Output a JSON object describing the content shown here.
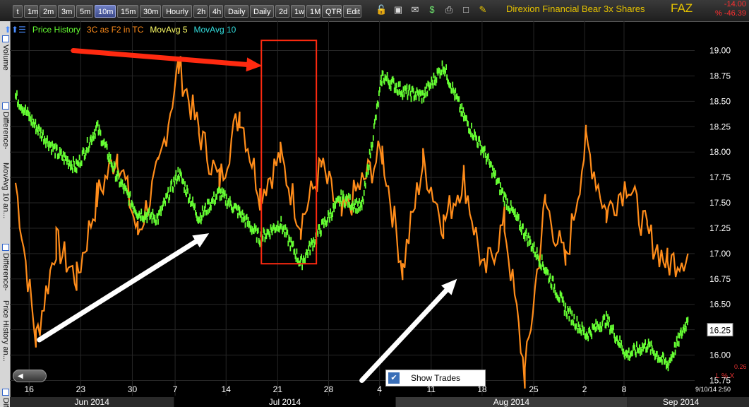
{
  "toolbar": {
    "buttons": [
      {
        "label": "t",
        "active": false
      },
      {
        "label": "1m",
        "active": false
      },
      {
        "label": "2m",
        "active": false
      },
      {
        "label": "3m",
        "active": false
      },
      {
        "label": "5m",
        "active": false
      },
      {
        "label": "10m",
        "active": true
      },
      {
        "label": "15m",
        "active": false
      },
      {
        "label": "30m",
        "active": false
      },
      {
        "label": "Hourly",
        "active": false
      },
      {
        "label": "2h",
        "active": false
      },
      {
        "label": "4h",
        "active": false
      },
      {
        "label": "Daily",
        "active": false
      },
      {
        "label": "Daily",
        "active": false
      },
      {
        "label": "2d",
        "active": false
      },
      {
        "label": "1w",
        "active": false
      },
      {
        "label": "1M",
        "active": false
      },
      {
        "label": "QTR",
        "active": false
      },
      {
        "label": "Edit",
        "active": false
      }
    ],
    "icons": [
      "lock-icon",
      "save-icon",
      "email-icon",
      "dollar-icon",
      "print-icon",
      "window-icon",
      "pencil-icon"
    ],
    "title": "Direxion Financial Bear 3x Shares",
    "symbol": "FAZ",
    "change": "-14.00",
    "change_pct": "% -46.39"
  },
  "panels": [
    {
      "label": "Volume"
    },
    {
      "label": "Difference-"
    },
    {
      "label": "MovAvg 10 an..."
    },
    {
      "label": "Difference-"
    },
    {
      "label": "Price History an..."
    },
    {
      "label": "Diff"
    }
  ],
  "legend": [
    {
      "label": "Price History",
      "color": "#66ff33"
    },
    {
      "label": "3C as F2 in TC",
      "color": "#ff8c1a"
    },
    {
      "label": "MovAvg 5",
      "color": "#ffff66"
    },
    {
      "label": "MovAvg 10",
      "color": "#33dddd"
    }
  ],
  "show_trades": {
    "label": "Show Trades",
    "checked": true
  },
  "timestamp": "9/10/14 2:50",
  "bottom_right": {
    "value": "0.26",
    "label": "L % X"
  },
  "colors": {
    "price": "#66ff33",
    "indicator": "#ff8c1a",
    "annotation_red": "#ff2a10",
    "annotation_white": "#ffffff",
    "grid": "#2a2a2a"
  },
  "chart_data": {
    "type": "line",
    "title": "Direxion Financial Bear 3x Shares",
    "xlabel": "",
    "ylabel": "",
    "ylim": [
      15.6,
      19.15
    ],
    "y_ticks": [
      "19.00",
      "18.75",
      "18.50",
      "18.25",
      "18.00",
      "17.75",
      "17.50",
      "17.25",
      "17.00",
      "16.75",
      "16.50",
      "16.25",
      "16.00",
      "15.75"
    ],
    "y_tick_values": [
      19.0,
      18.75,
      18.5,
      18.25,
      18.0,
      17.75,
      17.5,
      17.25,
      17.0,
      16.75,
      16.5,
      16.25,
      16.0,
      15.75
    ],
    "last_price": "16.25",
    "x_ticks": [
      "16",
      "23",
      "30",
      "7",
      "14",
      "21",
      "28",
      "4",
      "11",
      "18",
      "25",
      "2",
      "8"
    ],
    "months": [
      "Jun 2014",
      "Jul 2014",
      "Aug 2014",
      "Sep 2014"
    ],
    "series": [
      {
        "name": "Price History",
        "x": [
          0,
          3,
          6,
          9,
          12,
          15,
          18,
          21,
          24,
          27,
          30,
          33,
          36,
          39,
          42,
          45,
          48,
          51,
          54,
          57,
          60,
          63,
          66,
          69,
          72,
          75,
          78,
          81,
          84,
          87,
          90,
          93,
          96,
          99
        ],
        "values": [
          18.55,
          18.25,
          18.0,
          17.85,
          18.25,
          17.75,
          17.4,
          17.35,
          17.8,
          17.35,
          17.6,
          17.4,
          17.15,
          17.3,
          16.9,
          17.25,
          17.55,
          17.45,
          18.75,
          18.6,
          18.55,
          18.85,
          18.35,
          18.0,
          17.55,
          17.2,
          16.85,
          16.45,
          16.2,
          16.35,
          16.0,
          16.1,
          15.9,
          16.35
        ]
      },
      {
        "name": "3C as F2 in TC",
        "x": [
          0,
          3,
          6,
          9,
          12,
          15,
          18,
          21,
          24,
          27,
          30,
          33,
          36,
          39,
          42,
          45,
          48,
          51,
          54,
          57,
          60,
          63,
          66,
          69,
          72,
          75,
          78,
          81,
          84,
          87,
          90,
          93,
          96,
          99
        ],
        "values": [
          17.7,
          16.15,
          17.1,
          16.75,
          17.55,
          18.0,
          17.2,
          17.8,
          18.85,
          18.2,
          17.7,
          18.4,
          17.6,
          17.95,
          17.3,
          17.85,
          17.35,
          17.7,
          18.0,
          16.85,
          17.9,
          17.3,
          17.75,
          16.8,
          17.3,
          15.8,
          17.5,
          16.9,
          18.1,
          17.4,
          17.7,
          17.2,
          16.9,
          17.0
        ]
      }
    ],
    "x_range": [
      0,
      100
    ],
    "annotations": [
      {
        "type": "arrow",
        "color": "red",
        "from": [
          8.5,
          19.0
        ],
        "to": [
          36.3,
          18.85
        ]
      },
      {
        "type": "rect",
        "color": "red",
        "x": [
          36.2,
          44.3
        ],
        "y": [
          16.9,
          19.1
        ]
      },
      {
        "type": "arrow",
        "color": "white",
        "from": [
          3.5,
          16.15
        ],
        "to": [
          28.5,
          17.2
        ]
      },
      {
        "type": "arrow",
        "color": "white",
        "from": [
          51,
          15.75
        ],
        "to": [
          65,
          16.75
        ]
      }
    ],
    "grid": true,
    "legend_position": "top-left"
  }
}
